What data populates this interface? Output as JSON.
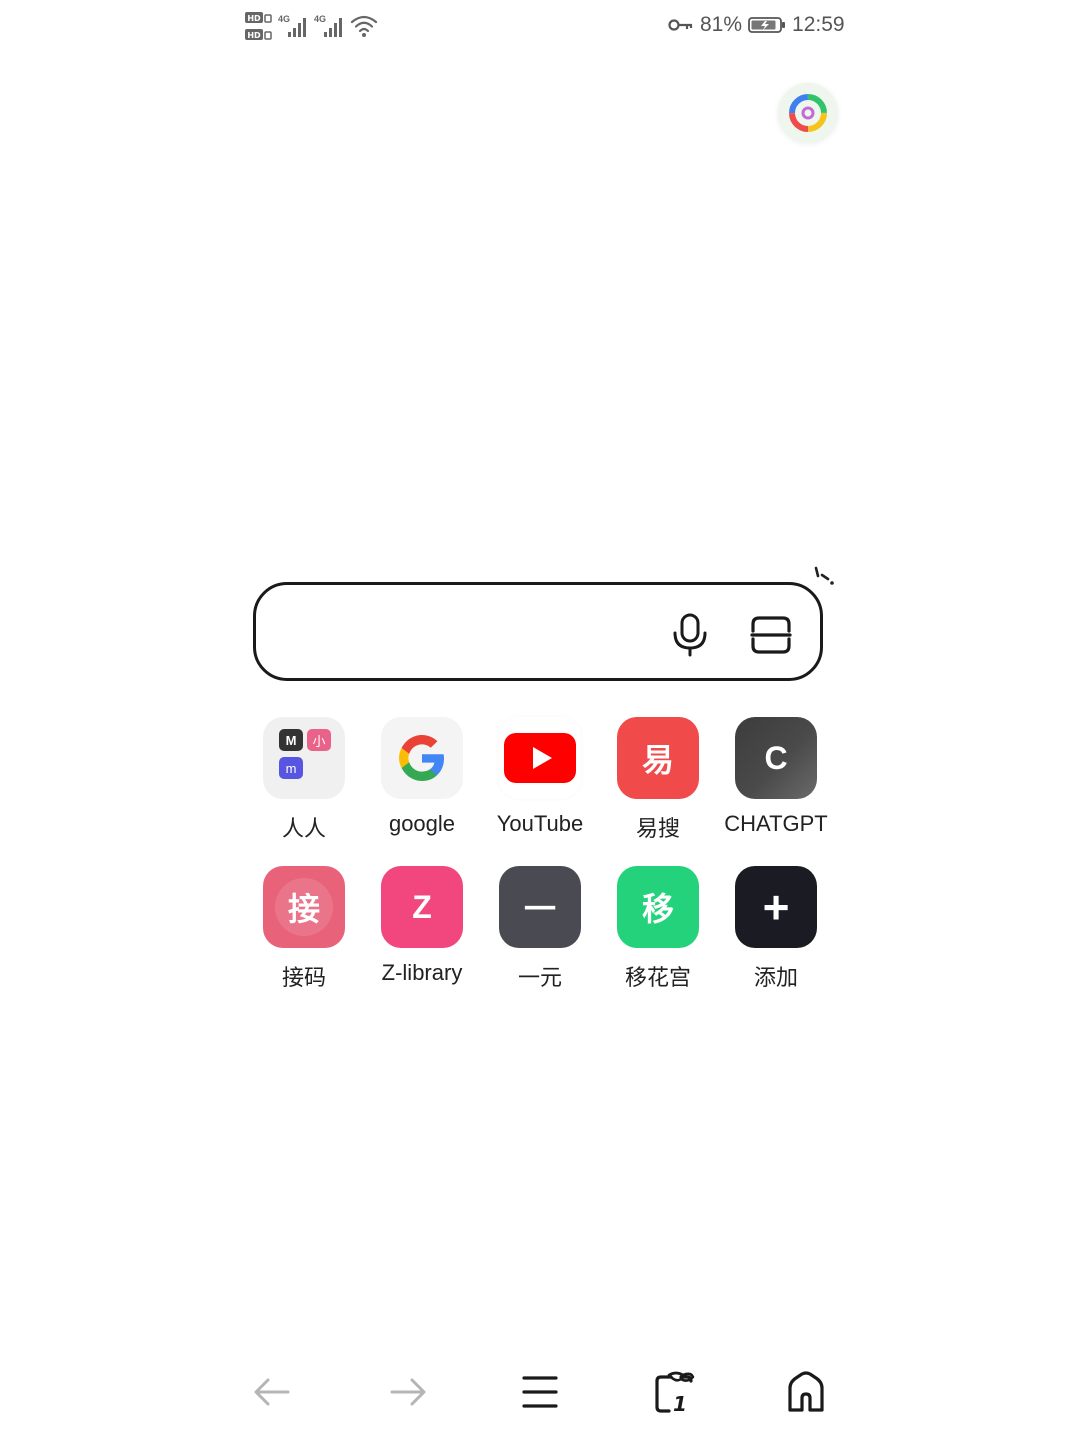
{
  "status_bar": {
    "network_1": "4G",
    "network_2": "4G",
    "battery_percent": "81%",
    "time": "12:59"
  },
  "search": {
    "value": "",
    "placeholder": ""
  },
  "shortcuts": [
    {
      "label": "人人",
      "glyph": "",
      "color": "#f0f0f0"
    },
    {
      "label": "google",
      "glyph": "",
      "color": "#f4f4f4"
    },
    {
      "label": "YouTube",
      "glyph": "",
      "color": "#ffffff"
    },
    {
      "label": "易搜",
      "glyph": "易",
      "color": "#f04a4a"
    },
    {
      "label": "CHATGPT",
      "glyph": "C",
      "color": "#4a4a4a"
    },
    {
      "label": "接码",
      "glyph": "接",
      "color": "#e8627a"
    },
    {
      "label": "Z-library",
      "glyph": "Z",
      "color": "#f2467f"
    },
    {
      "label": "一元",
      "glyph": "一",
      "color": "#4a4a52"
    },
    {
      "label": "移花宫",
      "glyph": "移",
      "color": "#24d27c"
    },
    {
      "label": "添加",
      "glyph": "+",
      "color": "#1b1b24"
    }
  ],
  "renren_badges": {
    "m_upper": "M",
    "xiao": "小",
    "m_lower": "m"
  },
  "toolbar": {
    "back_icon": "arrow-left-icon",
    "forward_icon": "arrow-right-icon",
    "menu_icon": "menu-icon",
    "tabs_icon": "tabs-icon",
    "tabs_count": "1",
    "home_icon": "home-icon"
  }
}
